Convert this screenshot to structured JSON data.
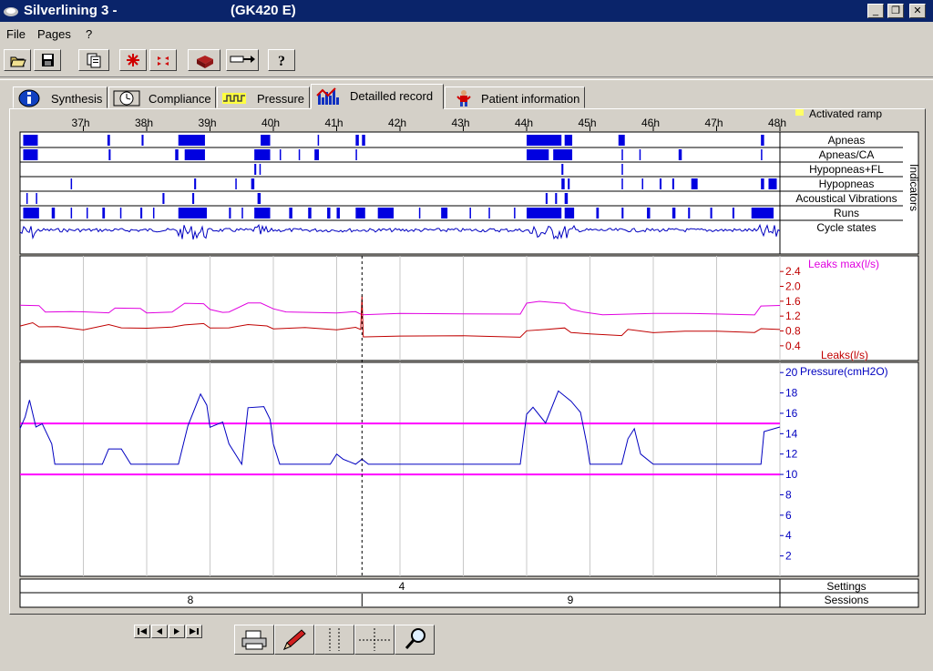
{
  "window": {
    "title": "Silverlining 3 -",
    "device": "(GK420 E)"
  },
  "menu": [
    {
      "label": "File"
    },
    {
      "label": "Pages"
    },
    {
      "label": "?"
    }
  ],
  "toolbar": [
    "open-folder-icon",
    "save-disk-icon",
    "print-copies-icon",
    "expand-icon",
    "collapse-icon",
    "device-icon",
    "transfer-icon",
    "help-icon"
  ],
  "tabs": [
    {
      "label": "Synthesis",
      "icon": "info-icon"
    },
    {
      "label": "Compliance",
      "icon": "clock-icon"
    },
    {
      "label": "Pressure",
      "icon": "pressure-wave-icon"
    },
    {
      "label": "Detailled record",
      "icon": "bar-chart-icon",
      "active": true
    },
    {
      "label": "Patient information",
      "icon": "person-icon"
    }
  ],
  "legend": {
    "activated_ramp": "Activated ramp",
    "ramp_color": "#ffff66"
  },
  "chart_data": [
    {
      "type": "table",
      "name": "indicators",
      "x_ticks": [
        "37h",
        "38h",
        "39h",
        "40h",
        "41h",
        "42h",
        "43h",
        "44h",
        "45h",
        "46h",
        "47h",
        "48h"
      ],
      "x_range_hours": [
        36.0,
        48.0
      ],
      "group_label": "Indicators",
      "rows": [
        {
          "label": "Apneas",
          "events_hours": [
            [
              36.05,
              36.28
            ],
            [
              37.38,
              37.42
            ],
            [
              37.92,
              37.95
            ],
            [
              38.5,
              38.92
            ],
            [
              39.8,
              39.95
            ],
            [
              40.7,
              40.72
            ],
            [
              41.3,
              41.35
            ],
            [
              41.4,
              41.45
            ],
            [
              44.0,
              44.55
            ],
            [
              44.6,
              44.72
            ],
            [
              45.45,
              45.55
            ],
            [
              47.7,
              47.75
            ]
          ]
        },
        {
          "label": "Apneas/CA",
          "events_hours": [
            [
              36.05,
              36.28
            ],
            [
              37.4,
              37.43
            ],
            [
              38.45,
              38.5
            ],
            [
              38.6,
              38.92
            ],
            [
              39.7,
              39.95
            ],
            [
              40.1,
              40.12
            ],
            [
              40.4,
              40.42
            ],
            [
              40.65,
              40.72
            ],
            [
              41.3,
              41.32
            ],
            [
              44.0,
              44.35
            ],
            [
              44.42,
              44.72
            ],
            [
              45.5,
              45.52
            ],
            [
              45.78,
              45.8
            ],
            [
              46.4,
              46.45
            ],
            [
              47.7,
              47.72
            ]
          ]
        },
        {
          "label": "Hypopneas+FL",
          "events_hours": [
            [
              39.7,
              39.73
            ],
            [
              39.78,
              39.8
            ],
            [
              44.55,
              44.58
            ],
            [
              45.5,
              45.52
            ]
          ]
        },
        {
          "label": "Hypopneas",
          "events_hours": [
            [
              36.8,
              36.82
            ],
            [
              38.75,
              38.78
            ],
            [
              39.4,
              39.42
            ],
            [
              39.65,
              39.7
            ],
            [
              44.55,
              44.6
            ],
            [
              44.65,
              44.68
            ],
            [
              45.5,
              45.52
            ],
            [
              45.82,
              45.84
            ],
            [
              46.1,
              46.13
            ],
            [
              46.3,
              46.33
            ],
            [
              46.6,
              46.7
            ],
            [
              47.7,
              47.75
            ],
            [
              47.82,
              47.95
            ]
          ]
        },
        {
          "label": "Acoustical Vibrations",
          "events_hours": [
            [
              36.1,
              36.12
            ],
            [
              36.25,
              36.27
            ],
            [
              38.25,
              38.28
            ],
            [
              38.72,
              38.75
            ],
            [
              39.75,
              39.8
            ],
            [
              44.3,
              44.33
            ],
            [
              44.45,
              44.48
            ],
            [
              44.6,
              44.65
            ]
          ]
        },
        {
          "label": "Runs",
          "events_hours": [
            [
              36.05,
              36.3
            ],
            [
              36.5,
              36.55
            ],
            [
              36.8,
              36.82
            ],
            [
              37.05,
              37.07
            ],
            [
              37.3,
              37.34
            ],
            [
              37.58,
              37.6
            ],
            [
              37.9,
              37.93
            ],
            [
              38.1,
              38.12
            ],
            [
              38.5,
              38.95
            ],
            [
              39.3,
              39.33
            ],
            [
              39.5,
              39.52
            ],
            [
              39.7,
              39.95
            ],
            [
              40.25,
              40.3
            ],
            [
              40.55,
              40.6
            ],
            [
              40.85,
              40.9
            ],
            [
              41.0,
              41.05
            ],
            [
              41.3,
              41.45
            ],
            [
              41.65,
              41.9
            ],
            [
              42.3,
              42.32
            ],
            [
              42.65,
              42.75
            ],
            [
              43.1,
              43.12
            ],
            [
              43.4,
              43.42
            ],
            [
              43.8,
              43.82
            ],
            [
              44.0,
              44.55
            ],
            [
              44.6,
              44.75
            ],
            [
              45.1,
              45.14
            ],
            [
              45.5,
              45.53
            ],
            [
              45.9,
              45.95
            ],
            [
              46.3,
              46.35
            ],
            [
              46.55,
              46.58
            ],
            [
              46.9,
              46.93
            ],
            [
              47.25,
              47.28
            ],
            [
              47.55,
              47.9
            ]
          ]
        },
        {
          "label": "Cycle states"
        }
      ],
      "cycle_states_active_hours": [
        [
          36.0,
          36.3
        ],
        [
          38.5,
          38.95
        ],
        [
          39.7,
          39.95
        ],
        [
          44.0,
          44.75
        ],
        [
          47.6,
          47.95
        ]
      ]
    },
    {
      "type": "line",
      "name": "leaks",
      "x_range_hours": [
        36.0,
        48.0
      ],
      "y_ticks": [
        "2.4",
        "2.0",
        "1.6",
        "1.2",
        "0.8",
        "0.4"
      ],
      "ylim": [
        0.2,
        2.6
      ],
      "cursor_hour": 41.4,
      "series": [
        {
          "name": "Leaks max(l/s)",
          "color": "#e000e0",
          "x": [
            36.0,
            36.3,
            36.4,
            36.8,
            37.0,
            37.4,
            37.5,
            37.9,
            38.0,
            38.4,
            38.6,
            38.9,
            39.0,
            39.2,
            39.3,
            39.6,
            39.8,
            40.0,
            40.2,
            41.0,
            41.3,
            41.4,
            42.0,
            43.0,
            43.9,
            44.0,
            44.2,
            44.6,
            44.7,
            44.9,
            45.2,
            46.0,
            46.5,
            47.0,
            47.6,
            47.7,
            48.0
          ],
          "y": [
            1.5,
            1.5,
            1.3,
            1.3,
            1.3,
            1.3,
            1.4,
            1.4,
            1.3,
            1.3,
            1.55,
            1.55,
            1.4,
            1.3,
            1.3,
            1.55,
            1.55,
            1.4,
            1.3,
            1.3,
            1.3,
            1.25,
            1.25,
            1.25,
            1.25,
            1.55,
            1.6,
            1.55,
            1.4,
            1.3,
            1.25,
            1.25,
            1.25,
            1.25,
            1.25,
            1.45,
            1.5
          ]
        },
        {
          "name": "Leaks(l/s)",
          "color": "#c00000",
          "x": [
            36.0,
            36.2,
            36.3,
            36.6,
            37.0,
            37.4,
            37.6,
            38.0,
            38.4,
            38.6,
            38.9,
            39.0,
            39.3,
            39.6,
            39.9,
            40.0,
            40.5,
            41.0,
            41.3,
            41.38,
            41.4,
            41.42,
            41.45,
            42.0,
            43.0,
            43.9,
            44.0,
            44.3,
            44.6,
            44.7,
            45.0,
            45.5,
            45.6,
            46.0,
            46.5,
            47.0,
            47.6,
            47.7,
            48.0
          ],
          "y": [
            0.95,
            1.0,
            0.9,
            0.9,
            0.85,
            0.95,
            0.9,
            0.88,
            0.92,
            0.95,
            1.0,
            0.9,
            0.9,
            0.95,
            0.95,
            0.88,
            0.9,
            0.85,
            0.88,
            0.85,
            1.75,
            0.65,
            0.65,
            0.65,
            0.65,
            0.65,
            0.8,
            0.85,
            0.9,
            0.75,
            0.7,
            0.7,
            0.85,
            0.75,
            0.8,
            0.8,
            0.75,
            0.85,
            0.85
          ]
        }
      ]
    },
    {
      "type": "line",
      "name": "pressure",
      "x_range_hours": [
        36.0,
        48.0
      ],
      "ylabel": "Pressure(cmH2O)",
      "y_ticks": [
        "20",
        "18",
        "16",
        "14",
        "12",
        "10",
        "8",
        "6",
        "4",
        "2"
      ],
      "ylim": [
        0,
        21
      ],
      "cursor_hour": 41.4,
      "reference_lines": [
        {
          "value": 15,
          "color": "#ff00ff"
        },
        {
          "value": 10,
          "color": "#ff00ff"
        }
      ],
      "series": [
        {
          "name": "Pressure",
          "color": "#0000c0",
          "x": [
            36.0,
            36.08,
            36.15,
            36.25,
            36.35,
            36.5,
            36.55,
            36.8,
            37.0,
            37.3,
            37.4,
            37.6,
            37.75,
            38.0,
            38.5,
            38.65,
            38.85,
            38.95,
            39.0,
            39.2,
            39.3,
            39.5,
            39.6,
            39.85,
            39.95,
            40.0,
            40.1,
            40.2,
            40.6,
            40.9,
            41.0,
            41.1,
            41.3,
            41.4,
            41.5,
            41.7,
            42.0,
            43.0,
            43.9,
            44.0,
            44.1,
            44.3,
            44.5,
            44.7,
            44.85,
            44.95,
            45.0,
            45.1,
            45.5,
            45.6,
            45.7,
            45.8,
            46.0,
            47.0,
            47.6,
            47.7,
            47.75,
            48.0
          ],
          "y": [
            15.0,
            16.5,
            16.0,
            15.0,
            14.5,
            13.0,
            11.0,
            11.0,
            11.0,
            11.0,
            12.5,
            12.5,
            11.0,
            11.0,
            11.0,
            15.5,
            16.5,
            17.0,
            15.0,
            15.2,
            13.0,
            11.0,
            15.2,
            16.0,
            15.8,
            13.0,
            11.0,
            11.0,
            11.0,
            11.0,
            12.0,
            11.5,
            11.0,
            11.5,
            11.0,
            11.0,
            11.0,
            11.0,
            11.0,
            15.5,
            16.0,
            16.5,
            17.0,
            16.5,
            15.0,
            13.0,
            11.0,
            11.0,
            11.0,
            13.5,
            15.5,
            12.0,
            11.0,
            11.0,
            11.0,
            11.0,
            15.0,
            15.2
          ]
        }
      ]
    },
    {
      "type": "table",
      "name": "settings-sessions",
      "rows": [
        {
          "label": "Settings",
          "segments": [
            {
              "value": "4"
            }
          ]
        },
        {
          "label": "Sessions",
          "segments": [
            {
              "value": "8"
            },
            {
              "value": "9"
            }
          ],
          "boundary_hour": 41.4
        }
      ]
    }
  ],
  "nav_buttons": [
    "first-icon",
    "prev-icon",
    "next-icon",
    "last-icon"
  ],
  "tool_buttons": [
    "print-icon",
    "pencil-icon",
    "vertical-lines-icon",
    "crosshair-icon",
    "magnifier-icon"
  ]
}
